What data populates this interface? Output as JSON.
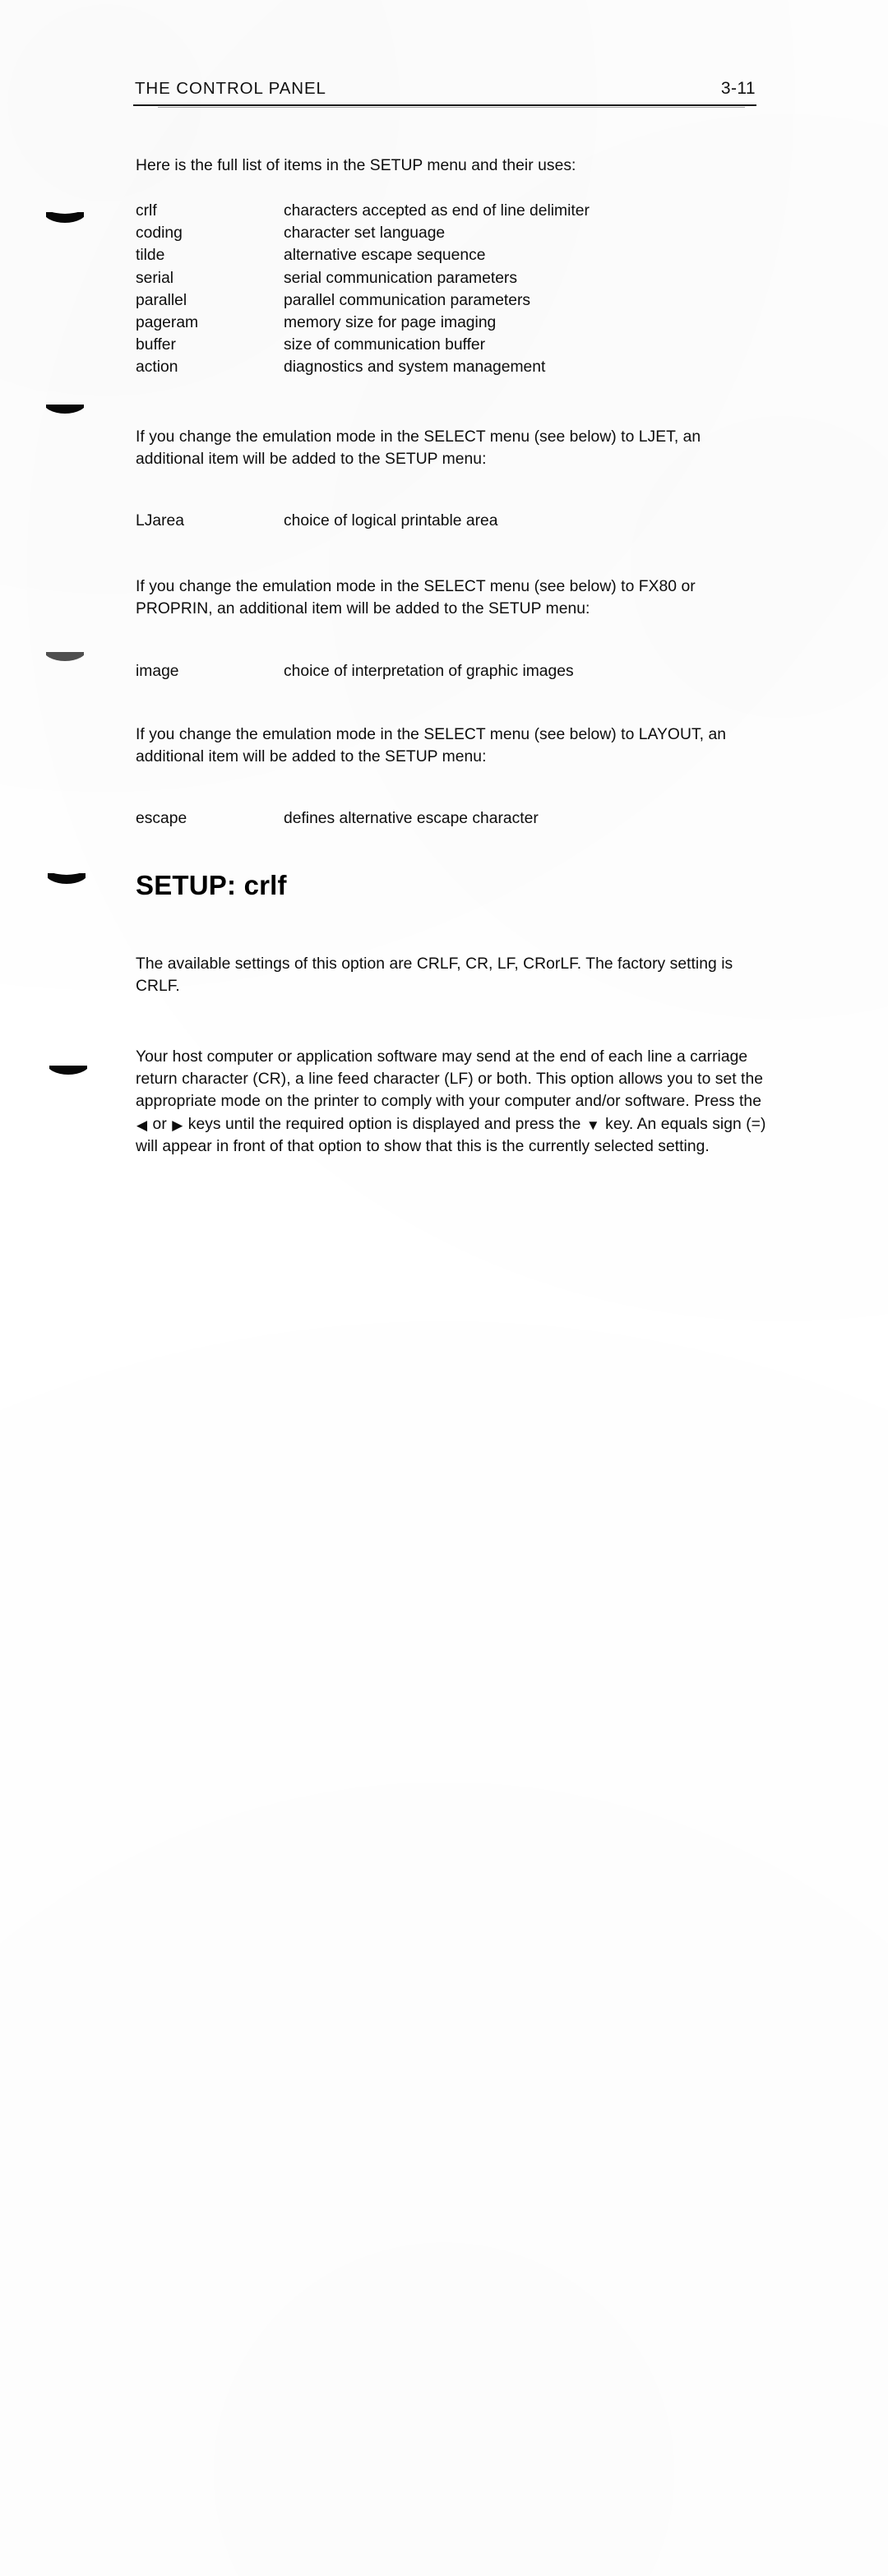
{
  "document": {
    "header": {
      "title": "THE CONTROL PANEL",
      "folio": "3-11"
    },
    "intro": "Here is the full list of items in the SETUP menu and their uses:",
    "setup_items": [
      {
        "term": "crlf",
        "desc": "characters accepted as end of line delimiter"
      },
      {
        "term": "coding",
        "desc": "character set language"
      },
      {
        "term": "tilde",
        "desc": "alternative escape sequence"
      },
      {
        "term": "serial",
        "desc": "serial communication parameters"
      },
      {
        "term": "parallel",
        "desc": "parallel communication parameters"
      },
      {
        "term": "pageram",
        "desc": "memory size for page imaging"
      },
      {
        "term": "buffer",
        "desc": "size of communication buffer"
      },
      {
        "term": "action",
        "desc": "diagnostics and system management"
      }
    ],
    "ljet": {
      "paragraph": "If you change the emulation mode in the SELECT menu (see below) to LJET, an additional item will be added to the SETUP menu:",
      "item": {
        "term": "LJarea",
        "desc": "choice of logical printable area"
      }
    },
    "fx80": {
      "paragraph": "If you change the emulation mode in the SELECT menu (see below) to FX80 or PROPRIN, an additional item will be added to the SETUP menu:",
      "item": {
        "term": "image",
        "desc": "choice of interpretation of graphic images"
      }
    },
    "layout": {
      "paragraph": "If you change the emulation mode in the SELECT menu (see below) to LAYOUT, an additional item will be added to the SETUP menu:",
      "item": {
        "term": "escape",
        "desc": "defines alternative escape character"
      }
    },
    "section": {
      "heading": "SETUP: crlf",
      "settings_paragraph": "The available settings of this option are CRLF, CR, LF, CRorLF. The factory setting is CRLF.",
      "explanation_part1": "Your host computer or application software may send at the end of each line a carriage return character (CR), a line feed character (LF) or both. This option allows you to set the appropriate mode on the printer to comply with your computer and/or software. Press the ",
      "explanation_part2": " or ",
      "explanation_part3": " keys until the required option is displayed and press the ",
      "explanation_part4": " key. An equals sign (=) will appear in front of that option to show that this is the currently selected setting.",
      "key_left_glyph": "◀",
      "key_right_glyph": "▶",
      "key_down_glyph": "▼"
    }
  },
  "scan_artifacts": {
    "margin_marks_count": 5,
    "ink_color": "#0d0d0d",
    "paper_color": "#ffffff"
  }
}
